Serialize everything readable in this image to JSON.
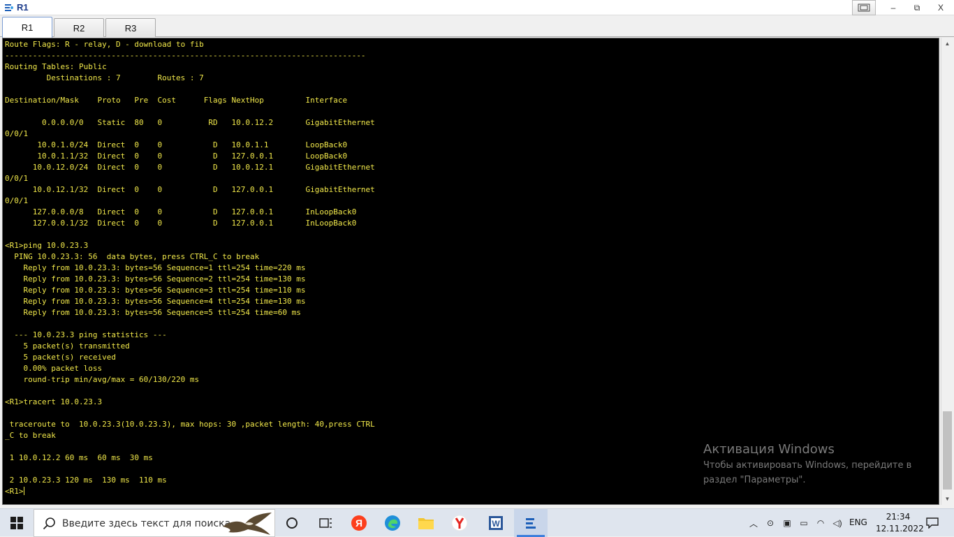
{
  "window": {
    "title": "R1",
    "controls": {
      "minimize": "‒",
      "maximize": "⧉",
      "close": "X"
    }
  },
  "tabs": [
    {
      "label": "R1",
      "active": true
    },
    {
      "label": "R2",
      "active": false
    },
    {
      "label": "R3",
      "active": false
    }
  ],
  "terminal": {
    "lines": [
      "Route Flags: R - relay, D - download to fib",
      "------------------------------------------------------------------------------",
      "Routing Tables: Public",
      "         Destinations : 7        Routes : 7",
      "",
      "Destination/Mask    Proto   Pre  Cost      Flags NextHop         Interface",
      "",
      "        0.0.0.0/0   Static  80   0          RD   10.0.12.2       GigabitEthernet",
      "0/0/1",
      "       10.0.1.0/24  Direct  0    0           D   10.0.1.1        LoopBack0",
      "       10.0.1.1/32  Direct  0    0           D   127.0.0.1       LoopBack0",
      "      10.0.12.0/24  Direct  0    0           D   10.0.12.1       GigabitEthernet",
      "0/0/1",
      "      10.0.12.1/32  Direct  0    0           D   127.0.0.1       GigabitEthernet",
      "0/0/1",
      "      127.0.0.0/8   Direct  0    0           D   127.0.0.1       InLoopBack0",
      "      127.0.0.1/32  Direct  0    0           D   127.0.0.1       InLoopBack0",
      "",
      "<R1>ping 10.0.23.3",
      "  PING 10.0.23.3: 56  data bytes, press CTRL_C to break",
      "    Reply from 10.0.23.3: bytes=56 Sequence=1 ttl=254 time=220 ms",
      "    Reply from 10.0.23.3: bytes=56 Sequence=2 ttl=254 time=130 ms",
      "    Reply from 10.0.23.3: bytes=56 Sequence=3 ttl=254 time=110 ms",
      "    Reply from 10.0.23.3: bytes=56 Sequence=4 ttl=254 time=130 ms",
      "    Reply from 10.0.23.3: bytes=56 Sequence=5 ttl=254 time=60 ms",
      "",
      "  --- 10.0.23.3 ping statistics ---",
      "    5 packet(s) transmitted",
      "    5 packet(s) received",
      "    0.00% packet loss",
      "    round-trip min/avg/max = 60/130/220 ms",
      "",
      "<R1>tracert 10.0.23.3",
      "",
      " traceroute to  10.0.23.3(10.0.23.3), max hops: 30 ,packet length: 40,press CTRL",
      "_C to break",
      "",
      " 1 10.0.12.2 60 ms  60 ms  30 ms",
      "",
      " 2 10.0.23.3 120 ms  130 ms  110 ms"
    ],
    "prompt": "<R1>"
  },
  "watermark": {
    "title": "Активация Windows",
    "text": "Чтобы активировать Windows, перейдите в раздел \"Параметры\"."
  },
  "taskbar": {
    "search_placeholder": "Введите здесь текст для поиска",
    "language": "ENG",
    "time": "21:34",
    "date": "12.11.2022"
  }
}
